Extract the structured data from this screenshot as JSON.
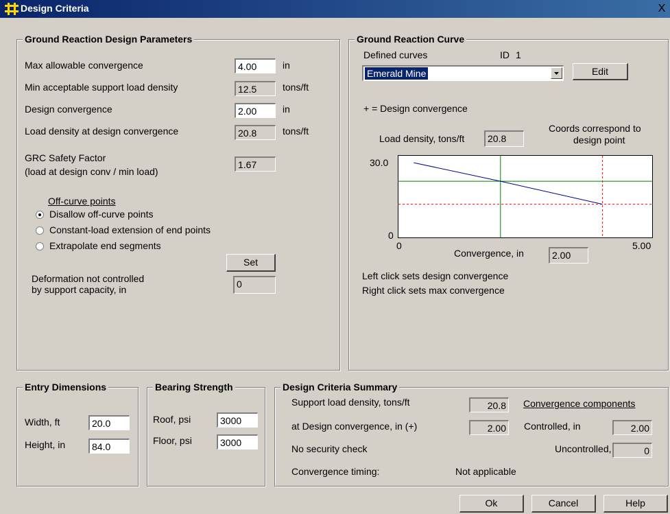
{
  "window": {
    "title": "Design Criteria",
    "close_glyph": "X"
  },
  "grdp": {
    "title": "Ground Reaction Design Parameters",
    "max_conv_label": "Max allowable convergence",
    "max_conv_value": "4.00",
    "max_conv_unit": "in",
    "min_load_label": "Min acceptable support load density",
    "min_load_value": "12.5",
    "min_load_unit": "tons/ft",
    "design_conv_label": "Design convergence",
    "design_conv_value": "2.00",
    "design_conv_unit": "in",
    "load_at_conv_label": "Load density at design convergence",
    "load_at_conv_value": "20.8",
    "load_at_conv_unit": "tons/ft",
    "sf_label_1": "GRC Safety Factor",
    "sf_label_2": "(load at design conv / min load)",
    "sf_value": "1.67",
    "offcurve_title": "Off-curve points",
    "radio1": "Disallow off-curve points",
    "radio2": "Constant-load extension of end points",
    "radio3": "Extrapolate end segments",
    "set_button": "Set",
    "deform_label_1": "Deformation not controlled",
    "deform_label_2": "by support capacity, in",
    "deform_value": "0"
  },
  "grc": {
    "title": "Ground Reaction Curve",
    "defined_curves_label": "Defined curves",
    "id_label": "ID",
    "id_value": "1",
    "curve_selected": "Emerald Mine",
    "edit_button": "Edit",
    "legend_note": "+ = Design convergence",
    "load_density_label": "Load density, tons/ft",
    "load_density_value": "20.8",
    "coords_note_1": "Coords correspond to",
    "coords_note_2": "design point",
    "convergence_label": "Convergence, in",
    "convergence_value": "2.00",
    "hint_left": "Left click sets design convergence",
    "hint_right": "Right click sets max convergence"
  },
  "chart_data": {
    "type": "line",
    "xlim": [
      0,
      5
    ],
    "ylim": [
      0,
      30
    ],
    "x_ticks": [
      "0",
      "5.00"
    ],
    "y_ticks": [
      "30.0",
      "0"
    ],
    "xlabel": "Convergence, in",
    "ylabel": "",
    "series": [
      {
        "x": [
          0.3,
          2.0,
          4.0
        ],
        "y": [
          27.5,
          20.8,
          12.5
        ]
      }
    ],
    "design_point": {
      "x": 2.0,
      "y": 20.8
    },
    "max_convergence": 4.0,
    "min_load": 12.5,
    "colors": {
      "curve": "#00008b",
      "design": "#008000",
      "limits": "#ff0000"
    },
    "grid": false
  },
  "entry": {
    "title": "Entry Dimensions",
    "width_label": "Width, ft",
    "width_value": "20.0",
    "height_label": "Height, in",
    "height_value": "84.0"
  },
  "bearing": {
    "title": "Bearing Strength",
    "roof_label": "Roof, psi",
    "roof_value": "3000",
    "floor_label": "Floor, psi",
    "floor_value": "3000"
  },
  "summary": {
    "title": "Design Criteria Summary",
    "support_label": "Support load density, tons/ft",
    "support_value": "20.8",
    "at_conv_label": "at Design convergence, in (+)",
    "at_conv_value": "2.00",
    "security": "No security check",
    "timing_label": "Convergence timing:",
    "timing_value": "Not applicable",
    "components_title": "Convergence components",
    "controlled_label": "Controlled, in",
    "controlled_value": "2.00",
    "uncontrolled_label": "Uncontrolled, in",
    "uncontrolled_value": "0"
  },
  "buttons": {
    "ok": "Ok",
    "cancel": "Cancel",
    "help": "Help"
  }
}
